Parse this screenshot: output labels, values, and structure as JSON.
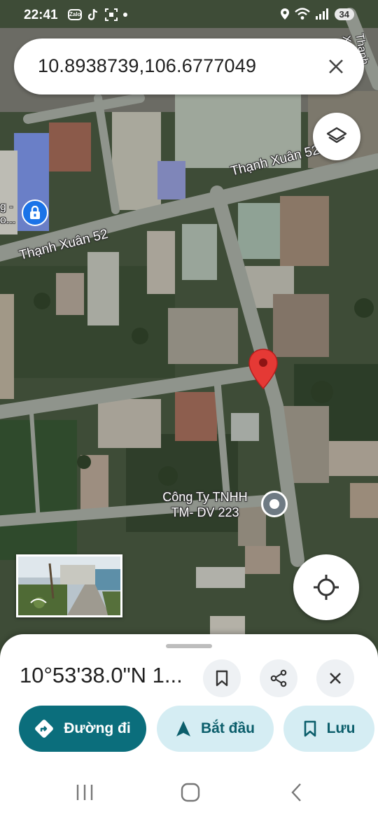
{
  "status_bar": {
    "time": "22:41",
    "battery": "34",
    "icons_left": [
      "zalo-icon",
      "tiktok-icon",
      "screenshot-icon",
      "dot-icon"
    ],
    "icons_right": [
      "location-icon",
      "wifi-icon",
      "signal-icon",
      "battery-icon"
    ]
  },
  "search": {
    "query": "10.8938739,106.6777049",
    "clear_icon": "close-icon"
  },
  "map": {
    "road_labels": [
      "Thạnh Xuân 52",
      "Thạnh Xuân 52"
    ],
    "poi": {
      "name_line1": "Công Ty TNHH",
      "name_line2": "TM- DV 223"
    },
    "left_poi": {
      "line1": "g -",
      "line2": "o..."
    },
    "edge_label": "Thạnh X",
    "pin_color": "#e53935"
  },
  "bottom_sheet": {
    "coords": "10°53'38.0\"N 1...",
    "directions_label": "Đường đi",
    "start_label": "Bắt đầu",
    "save_label": "Lưu",
    "accent": "#0b6e7c",
    "secondary_bg": "#d5edf3"
  }
}
